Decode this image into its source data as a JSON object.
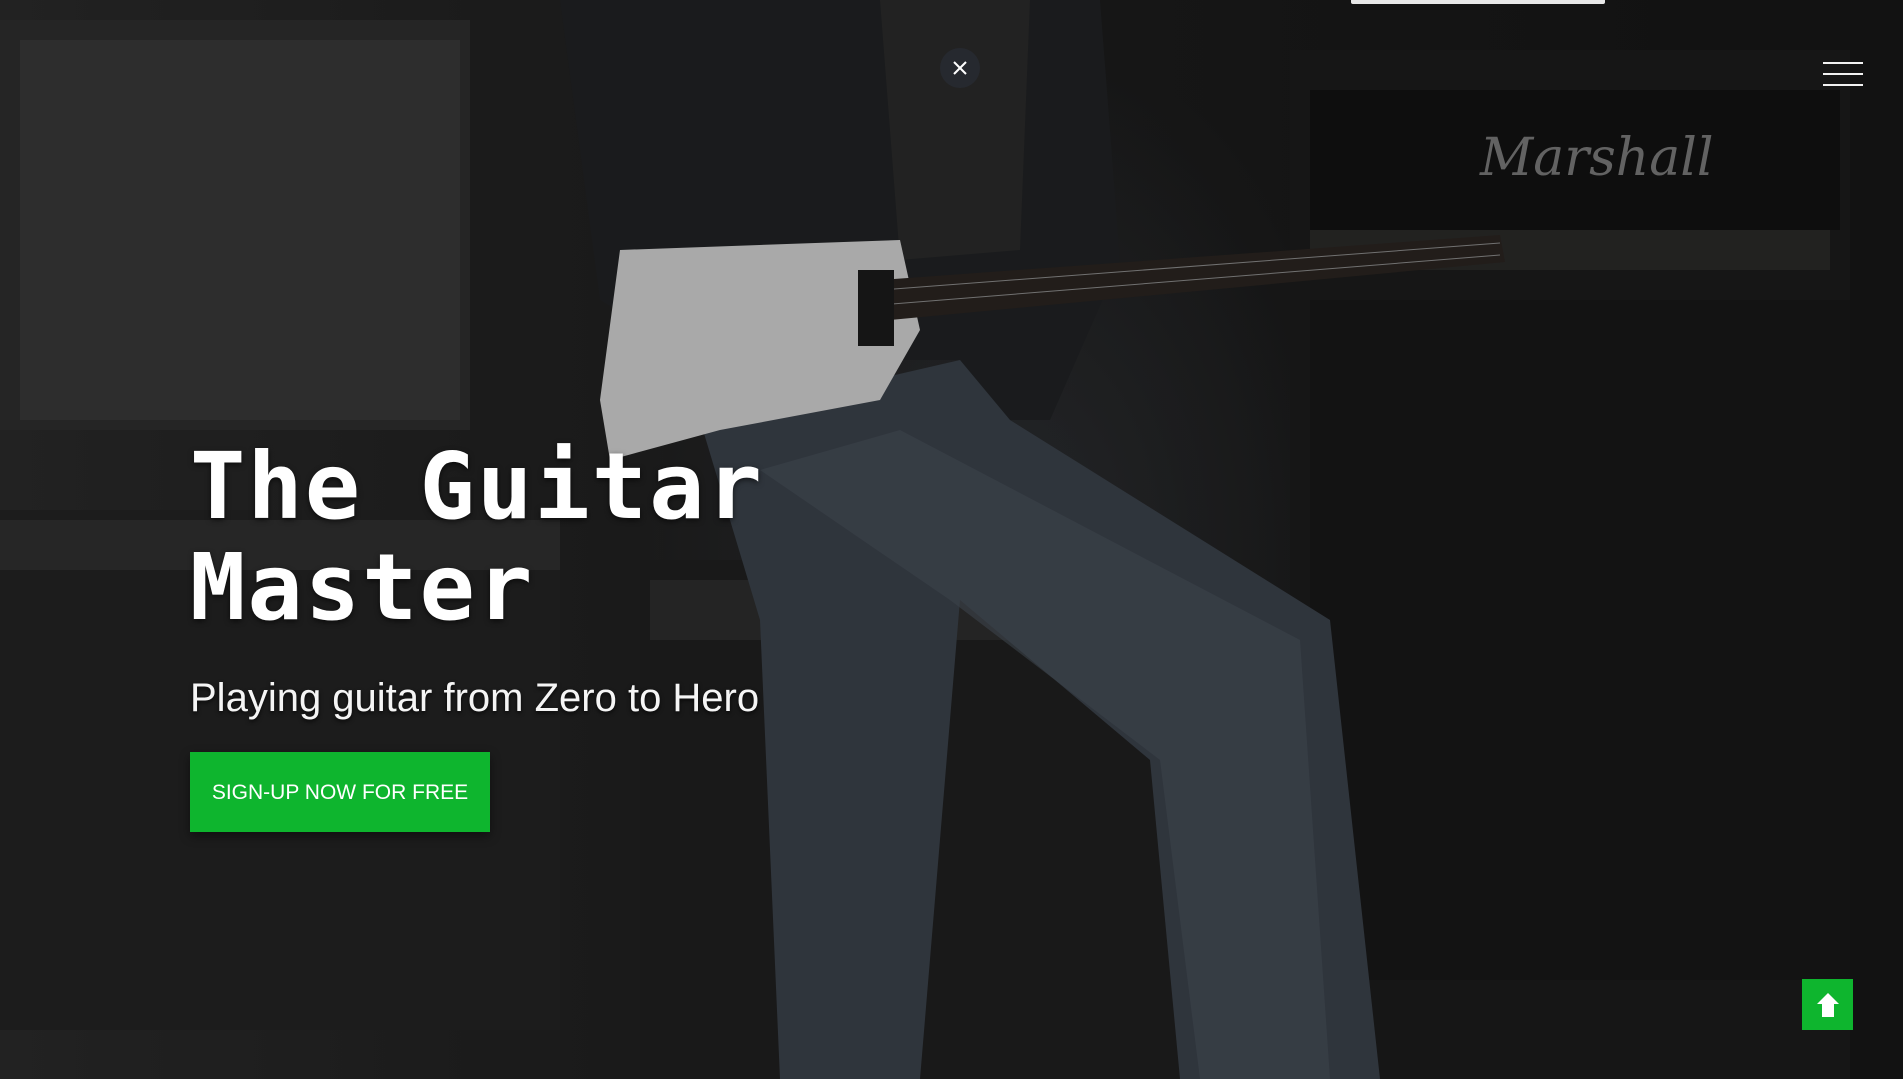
{
  "hero": {
    "background_image": "guitarist-amplifiers-photo",
    "title_line1": "The Guitar",
    "title_line2": "Master",
    "subtitle": "Playing guitar from Zero to Hero",
    "cta_label": "SIGN-UP NOW FOR FREE"
  },
  "controls": {
    "close_icon": "close-icon",
    "menu_icon": "hamburger-menu-icon",
    "scroll_top_icon": "arrow-up-icon"
  },
  "colors": {
    "accent": "#0eb52e",
    "text": "#ffffff"
  }
}
